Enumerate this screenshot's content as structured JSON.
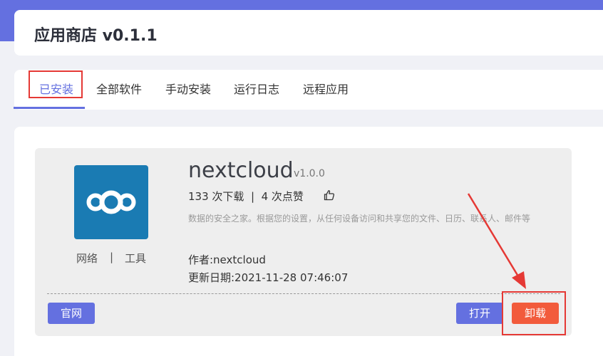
{
  "header": {
    "title": "应用商店 v0.1.1"
  },
  "tabs": [
    {
      "label": "已安装",
      "active": true
    },
    {
      "label": "全部软件",
      "active": false
    },
    {
      "label": "手动安装",
      "active": false
    },
    {
      "label": "运行日志",
      "active": false
    },
    {
      "label": "远程应用",
      "active": false
    }
  ],
  "app": {
    "name": "nextcloud",
    "version": "v1.0.0",
    "downloads": "133 次下载",
    "separator": "|",
    "likes": "4 次点赞",
    "description": "数据的安全之家。根据您的设置，从任何设备访问和共享您的文件、日历、联系人、邮件等",
    "author": "作者:nextcloud",
    "updated": "更新日期:2021-11-28 07:46:07",
    "tags": [
      "网络",
      "工具"
    ],
    "tag_separator": "|",
    "logo_icon": "nextcloud-logo-icon",
    "like_icon": "thumbs-up-icon"
  },
  "buttons": {
    "website": "官网",
    "open": "打开",
    "uninstall": "卸载"
  },
  "colors": {
    "accent": "#6470e0",
    "danger": "#f25b3c",
    "annotation": "#e53935",
    "logo_bg": "#1a7bb3"
  }
}
